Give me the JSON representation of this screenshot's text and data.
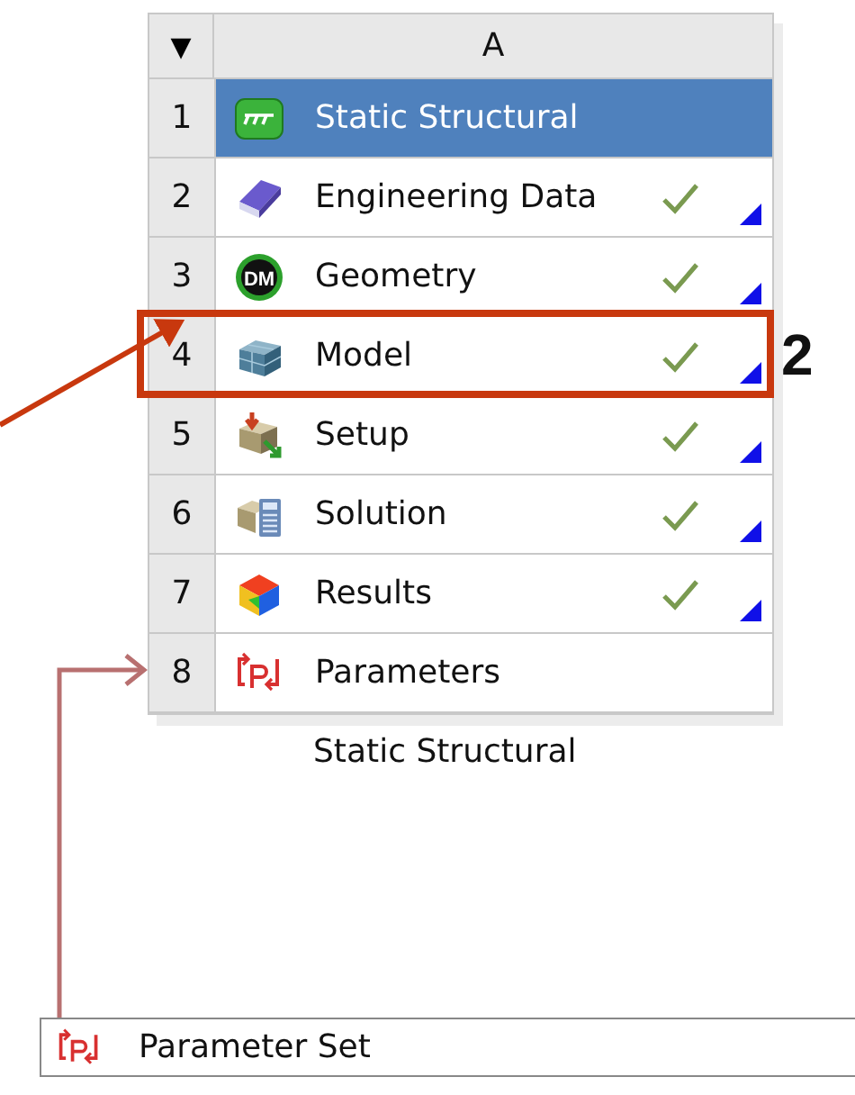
{
  "system": {
    "menu_glyph": "▼",
    "column_header": "A",
    "rows": [
      {
        "num": "1",
        "label": "Static Structural",
        "kind": "system",
        "selected": true,
        "checked": false,
        "annotated": false
      },
      {
        "num": "2",
        "label": "Engineering Data",
        "kind": "book",
        "selected": false,
        "checked": true,
        "annotated": false
      },
      {
        "num": "3",
        "label": "Geometry",
        "kind": "dm",
        "icon_text": "DM",
        "selected": false,
        "checked": true,
        "annotated": false
      },
      {
        "num": "4",
        "label": "Model",
        "kind": "mesh",
        "selected": false,
        "checked": true,
        "annotated": true
      },
      {
        "num": "5",
        "label": "Setup",
        "kind": "setup",
        "selected": false,
        "checked": true,
        "annotated": false
      },
      {
        "num": "6",
        "label": "Solution",
        "kind": "solution",
        "selected": false,
        "checked": true,
        "annotated": false
      },
      {
        "num": "7",
        "label": "Results",
        "kind": "results",
        "selected": false,
        "checked": true,
        "annotated": false
      },
      {
        "num": "8",
        "label": "Parameters",
        "kind": "parameters",
        "selected": false,
        "checked": false,
        "annotated": false
      }
    ],
    "caption": "Static Structural"
  },
  "annotation": {
    "label": "2"
  },
  "parameter_set": {
    "label": "Parameter Set"
  }
}
